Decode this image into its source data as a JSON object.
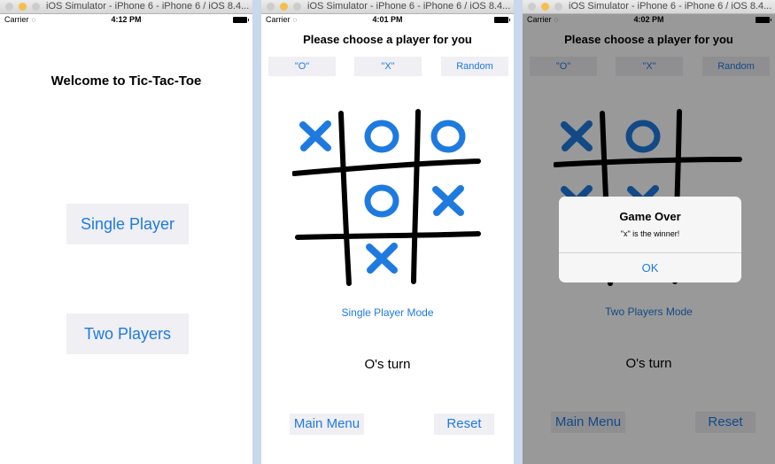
{
  "colors": {
    "accent": "#1f7ae0",
    "button_bg": "#efeff4",
    "mark_o_x": "#1f7ae0",
    "grid": "#000000"
  },
  "window1": {
    "title": "iOS Simulator - iPhone 6 - iPhone 6 / iOS 8.4...",
    "status": {
      "carrier": "Carrier",
      "time": "4:12 PM"
    },
    "welcome": "Welcome to Tic-Tac-Toe",
    "single_player": "Single Player",
    "two_players": "Two Players"
  },
  "window2": {
    "title": "iOS Simulator - iPhone 6 - iPhone 6 / iOS 8.4...",
    "status": {
      "carrier": "Carrier",
      "time": "4:01 PM"
    },
    "heading": "Please choose a player for you",
    "choice_o": "\"O\"",
    "choice_x": "\"X\"",
    "choice_random": "Random",
    "board": [
      [
        "X",
        "O",
        "O"
      ],
      [
        "",
        "O",
        "X"
      ],
      [
        "",
        "X",
        ""
      ]
    ],
    "mode": "Single Player Mode",
    "turn": "O's turn",
    "main_menu": "Main Menu",
    "reset": "Reset"
  },
  "window3": {
    "title": "iOS Simulator - iPhone 6 - iPhone 6 / iOS 8.4...",
    "status": {
      "carrier": "Carrier",
      "time": "4:02 PM"
    },
    "heading": "Please choose a player for you",
    "choice_o": "\"O\"",
    "choice_x": "\"X\"",
    "choice_random": "Random",
    "board": [
      [
        "X",
        "O",
        ""
      ],
      [
        "X",
        "X",
        ""
      ],
      [
        "",
        "",
        ""
      ]
    ],
    "mode": "Two Players Mode",
    "turn": "O's turn",
    "main_menu": "Main Menu",
    "reset": "Reset",
    "alert": {
      "title": "Game Over",
      "message": "\"x\" is the winner!",
      "ok": "OK"
    }
  }
}
